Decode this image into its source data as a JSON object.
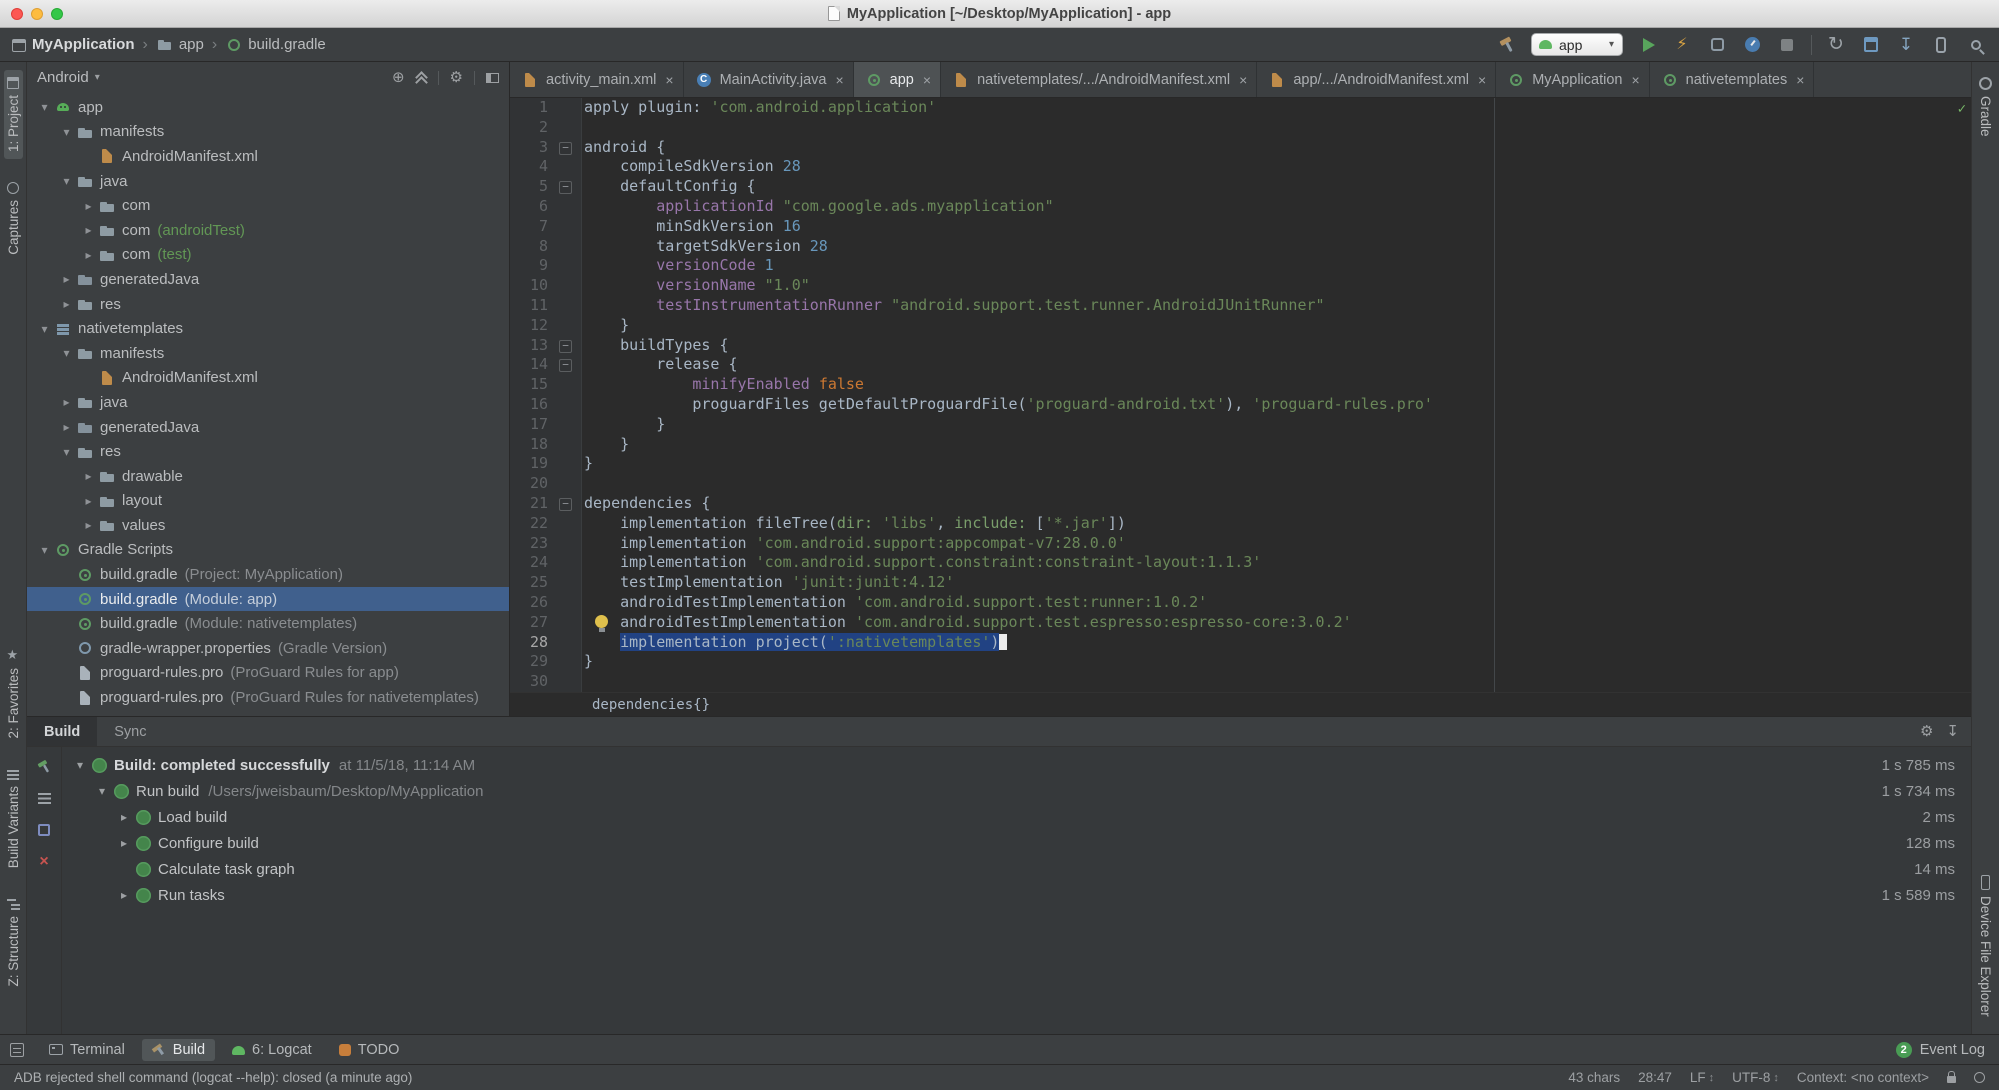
{
  "colors": {
    "accent_green": "#499C54",
    "selection_blue": "#214283",
    "tree_selection_blue": "#40608D",
    "string_green": "#6A8759",
    "number_blue": "#6897BB",
    "keyword_orange": "#CC7832",
    "property_purple": "#9876AA",
    "editor_bg": "#2B2B2B",
    "panel_bg": "#3C3F41"
  },
  "icons": {
    "expanded": "▾",
    "collapsed": "▸",
    "separator": "›",
    "close": "×",
    "check": "✓",
    "gear": "⚙",
    "bolt": "⚡",
    "sync": "↻",
    "locate": "⊕",
    "download": "↧",
    "dropdown": "▾",
    "updown": "↕"
  },
  "titlebar": {
    "title": "MyApplication [~/Desktop/MyApplication] - app"
  },
  "navbar": {
    "breadcrumbs": [
      {
        "label": "MyApplication",
        "icon": "project"
      },
      {
        "label": "app",
        "icon": "folder"
      },
      {
        "label": "build.gradle",
        "icon": "gradle"
      }
    ],
    "run_config": "app"
  },
  "left_stripe": {
    "top": [
      {
        "label": "1: Project",
        "icon": "project",
        "active": true
      },
      {
        "label": "Captures",
        "icon": "captures"
      }
    ],
    "bottom": [
      {
        "label": "2: Favorites",
        "icon": "favorites"
      },
      {
        "label": "Build Variants",
        "icon": "variants"
      },
      {
        "label": "Z: Structure",
        "icon": "structure"
      }
    ]
  },
  "right_stripe": {
    "top": [
      {
        "label": "Gradle",
        "icon": "gradle"
      }
    ],
    "bottom": [
      {
        "label": "Device File Explorer",
        "icon": "device"
      }
    ]
  },
  "project_panel": {
    "selector": "Android",
    "items": [
      {
        "depth": 0,
        "arrow": "open",
        "icon": "module-app",
        "label": "app"
      },
      {
        "depth": 1,
        "arrow": "open",
        "icon": "folder",
        "label": "manifests"
      },
      {
        "depth": 2,
        "arrow": "none",
        "icon": "manifest",
        "label": "AndroidManifest.xml"
      },
      {
        "depth": 1,
        "arrow": "open",
        "icon": "folder",
        "label": "java"
      },
      {
        "depth": 2,
        "arrow": "closed",
        "icon": "package",
        "label": "com"
      },
      {
        "depth": 2,
        "arrow": "closed",
        "icon": "package",
        "label": "com",
        "sub": "(androidTest)",
        "subStyle": "green"
      },
      {
        "depth": 2,
        "arrow": "closed",
        "icon": "package",
        "label": "com",
        "sub": "(test)",
        "subStyle": "green"
      },
      {
        "depth": 1,
        "arrow": "closed",
        "icon": "folder-gen",
        "label": "generatedJava"
      },
      {
        "depth": 1,
        "arrow": "closed",
        "icon": "folder-res",
        "label": "res"
      },
      {
        "depth": 0,
        "arrow": "open",
        "icon": "module-lib",
        "label": "nativetemplates"
      },
      {
        "depth": 1,
        "arrow": "open",
        "icon": "folder",
        "label": "manifests"
      },
      {
        "depth": 2,
        "arrow": "none",
        "icon": "manifest",
        "label": "AndroidManifest.xml"
      },
      {
        "depth": 1,
        "arrow": "closed",
        "icon": "folder",
        "label": "java"
      },
      {
        "depth": 1,
        "arrow": "closed",
        "icon": "folder-gen",
        "label": "generatedJava"
      },
      {
        "depth": 1,
        "arrow": "open",
        "icon": "folder-res",
        "label": "res"
      },
      {
        "depth": 2,
        "arrow": "closed",
        "icon": "folder",
        "label": "drawable"
      },
      {
        "depth": 2,
        "arrow": "closed",
        "icon": "folder",
        "label": "layout"
      },
      {
        "depth": 2,
        "arrow": "closed",
        "icon": "folder",
        "label": "values"
      },
      {
        "depth": 0,
        "arrow": "open",
        "icon": "gradle",
        "label": "Gradle Scripts"
      },
      {
        "depth": 1,
        "arrow": "none",
        "icon": "gradle",
        "label": "build.gradle",
        "sub": "(Project: MyApplication)"
      },
      {
        "depth": 1,
        "arrow": "none",
        "icon": "gradle",
        "label": "build.gradle",
        "sub": "(Module: app)",
        "selected": true
      },
      {
        "depth": 1,
        "arrow": "none",
        "icon": "gradle",
        "label": "build.gradle",
        "sub": "(Module: nativetemplates)"
      },
      {
        "depth": 1,
        "arrow": "none",
        "icon": "gradle-wrapper",
        "label": "gradle-wrapper.properties",
        "sub": "(Gradle Version)"
      },
      {
        "depth": 1,
        "arrow": "none",
        "icon": "file",
        "label": "proguard-rules.pro",
        "sub": "(ProGuard Rules for app)"
      },
      {
        "depth": 1,
        "arrow": "none",
        "icon": "file",
        "label": "proguard-rules.pro",
        "sub": "(ProGuard Rules for nativetemplates)"
      }
    ]
  },
  "editor": {
    "tabs": [
      {
        "label": "activity_main.xml",
        "icon": "xml",
        "closable": true
      },
      {
        "label": "MainActivity.java",
        "icon": "class",
        "closable": true
      },
      {
        "label": "app",
        "icon": "gradle",
        "active": true,
        "closable": true
      },
      {
        "label": "nativetemplates/.../AndroidManifest.xml",
        "icon": "xml",
        "closable": true
      },
      {
        "label": "app/.../AndroidManifest.xml",
        "icon": "xml",
        "closable": true
      },
      {
        "label": "MyApplication",
        "icon": "gradle",
        "closable": true
      },
      {
        "label": "nativetemplates",
        "icon": "gradle",
        "closable": true
      }
    ],
    "breadcrumb": "dependencies{}",
    "lines": [
      {
        "n": "1",
        "segs": [
          [
            "apply plugin: ",
            "p"
          ],
          [
            "'com.android.application'",
            "s"
          ]
        ]
      },
      {
        "n": "2",
        "segs": []
      },
      {
        "n": "3",
        "fold": "open",
        "segs": [
          [
            "android {",
            "p"
          ]
        ]
      },
      {
        "n": "4",
        "segs": [
          [
            "    compileSdkVersion ",
            "p"
          ],
          [
            "28",
            "n"
          ]
        ]
      },
      {
        "n": "5",
        "fold": "open",
        "segs": [
          [
            "    defaultConfig {",
            "p"
          ]
        ]
      },
      {
        "n": "6",
        "segs": [
          [
            "        ",
            "p"
          ],
          [
            "applicationId",
            "v"
          ],
          [
            " ",
            "p"
          ],
          [
            "\"com.google.ads.myapplication\"",
            "s"
          ]
        ]
      },
      {
        "n": "7",
        "segs": [
          [
            "        minSdkVersion ",
            "p"
          ],
          [
            "16",
            "n"
          ]
        ]
      },
      {
        "n": "8",
        "segs": [
          [
            "        targetSdkVersion ",
            "p"
          ],
          [
            "28",
            "n"
          ]
        ]
      },
      {
        "n": "9",
        "segs": [
          [
            "        ",
            "p"
          ],
          [
            "versionCode",
            "v"
          ],
          [
            " ",
            "p"
          ],
          [
            "1",
            "n"
          ]
        ]
      },
      {
        "n": "10",
        "segs": [
          [
            "        ",
            "p"
          ],
          [
            "versionName",
            "v"
          ],
          [
            " ",
            "p"
          ],
          [
            "\"1.0\"",
            "s"
          ]
        ]
      },
      {
        "n": "11",
        "segs": [
          [
            "        ",
            "p"
          ],
          [
            "testInstrumentationRunner",
            "v"
          ],
          [
            " ",
            "p"
          ],
          [
            "\"android.support.test.runner.AndroidJUnitRunner\"",
            "s"
          ]
        ]
      },
      {
        "n": "12",
        "segs": [
          [
            "    }",
            "p"
          ]
        ]
      },
      {
        "n": "13",
        "fold": "open",
        "segs": [
          [
            "    buildTypes {",
            "p"
          ]
        ]
      },
      {
        "n": "14",
        "fold": "open",
        "segs": [
          [
            "        release {",
            "p"
          ]
        ]
      },
      {
        "n": "15",
        "segs": [
          [
            "            ",
            "p"
          ],
          [
            "minifyEnabled",
            "v"
          ],
          [
            " ",
            "p"
          ],
          [
            "false",
            "k"
          ]
        ]
      },
      {
        "n": "16",
        "segs": [
          [
            "            proguardFiles getDefaultProguardFile(",
            "p"
          ],
          [
            "'proguard-android.txt'",
            "s"
          ],
          [
            "), ",
            "p"
          ],
          [
            "'proguard-rules.pro'",
            "s"
          ]
        ]
      },
      {
        "n": "17",
        "segs": [
          [
            "        }",
            "p"
          ]
        ]
      },
      {
        "n": "18",
        "segs": [
          [
            "    }",
            "p"
          ]
        ]
      },
      {
        "n": "19",
        "segs": [
          [
            "}",
            "p"
          ]
        ]
      },
      {
        "n": "20",
        "segs": []
      },
      {
        "n": "21",
        "fold": "open",
        "segs": [
          [
            "dependencies {",
            "p"
          ]
        ]
      },
      {
        "n": "22",
        "segs": [
          [
            "    implementation fileTree(",
            "p"
          ],
          [
            "dir:",
            "na"
          ],
          [
            " ",
            "p"
          ],
          [
            "'libs'",
            "s"
          ],
          [
            ", ",
            "p"
          ],
          [
            "include:",
            "na"
          ],
          [
            " [",
            "p"
          ],
          [
            "'*.jar'",
            "s"
          ],
          [
            "])",
            "p"
          ]
        ]
      },
      {
        "n": "23",
        "segs": [
          [
            "    implementation ",
            "p"
          ],
          [
            "'com.android.support:appcompat-v7:28.0.0'",
            "s"
          ]
        ]
      },
      {
        "n": "24",
        "segs": [
          [
            "    implementation ",
            "p"
          ],
          [
            "'com.android.support.constraint:constraint-layout:1.1.3'",
            "s"
          ]
        ]
      },
      {
        "n": "25",
        "segs": [
          [
            "    testImplementation ",
            "p"
          ],
          [
            "'junit:junit:4.12'",
            "s"
          ]
        ]
      },
      {
        "n": "26",
        "segs": [
          [
            "    androidTestImplementation ",
            "p"
          ],
          [
            "'com.android.support.test:runner:1.0.2'",
            "s"
          ]
        ]
      },
      {
        "n": "27",
        "segs": [
          [
            "    androidTestImplementation ",
            "p"
          ],
          [
            "'com.android.support.test.espresso:espresso-core:3.0.2'",
            "s"
          ]
        ]
      },
      {
        "n": "28",
        "current": true,
        "segs": [
          [
            "    ",
            "p"
          ],
          [
            "implementation project(",
            "p sel"
          ],
          [
            "':nativetemplates'",
            "s sel"
          ],
          [
            ")",
            "p sel"
          ],
          [
            "",
            "cursor"
          ]
        ]
      },
      {
        "n": "29",
        "segs": [
          [
            "}",
            "p"
          ]
        ]
      },
      {
        "n": "30",
        "segs": []
      }
    ]
  },
  "build_panel": {
    "tabs": [
      {
        "label": "Build",
        "active": true
      },
      {
        "label": "Sync"
      }
    ],
    "rows": [
      {
        "depth": 0,
        "arrow": "open",
        "strong": "Build: completed successfully",
        "text": "",
        "sub": "at 11/5/18, 11:14 AM",
        "dur": "1 s 785 ms"
      },
      {
        "depth": 1,
        "arrow": "open",
        "strong": "",
        "text": "Run build",
        "sub": "/Users/jweisbaum/Desktop/MyApplication",
        "dur": "1 s 734 ms"
      },
      {
        "depth": 2,
        "arrow": "closed",
        "strong": "",
        "text": "Load build",
        "sub": "",
        "dur": "2 ms"
      },
      {
        "depth": 2,
        "arrow": "closed",
        "strong": "",
        "text": "Configure build",
        "sub": "",
        "dur": "128 ms"
      },
      {
        "depth": 2,
        "arrow": "none",
        "strong": "",
        "text": "Calculate task graph",
        "sub": "",
        "dur": "14 ms"
      },
      {
        "depth": 2,
        "arrow": "closed",
        "strong": "",
        "text": "Run tasks",
        "sub": "",
        "dur": "1 s 589 ms"
      }
    ]
  },
  "bottom_bar": {
    "items": [
      {
        "label": "Terminal",
        "icon": "terminal"
      },
      {
        "label": "Build",
        "icon": "hammer",
        "active": true
      },
      {
        "label": "6: Logcat",
        "icon": "logcat"
      },
      {
        "label": "TODO",
        "icon": "todo"
      }
    ],
    "event_log": {
      "badge": "2",
      "label": "Event Log"
    }
  },
  "status_bar": {
    "message": "ADB rejected shell command (logcat --help): closed (a minute ago)",
    "segments": [
      {
        "label": "43 chars",
        "clickable": false
      },
      {
        "label": "28:47"
      },
      {
        "label": "LF",
        "arrows": true
      },
      {
        "label": "UTF-8",
        "arrows": true
      },
      {
        "label": "Context: <no context>"
      }
    ]
  }
}
